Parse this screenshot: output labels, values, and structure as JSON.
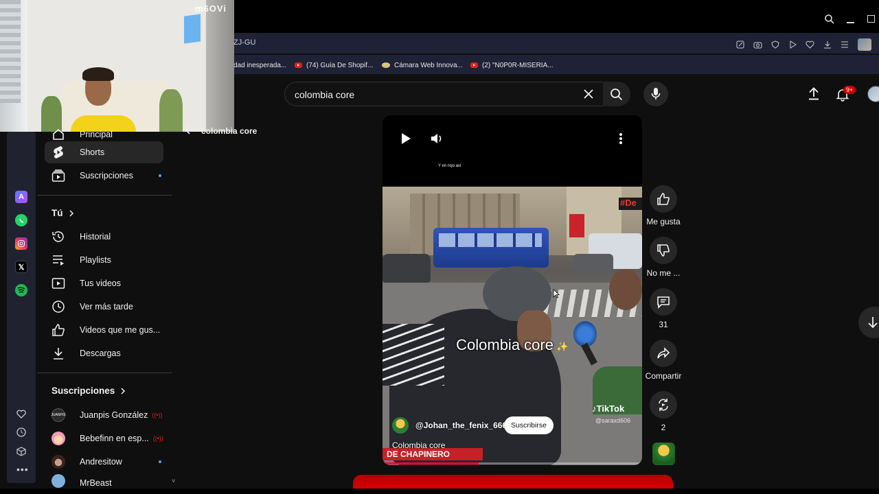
{
  "browser": {
    "url_fragment": "ZJ-GU",
    "bookmarks": [
      {
        "label": "dad inesperada...",
        "icon": "none"
      },
      {
        "label": "(74) Guía De Shopif...",
        "icon": "youtube-icon"
      },
      {
        "label": "Cámara Web Innova...",
        "icon": "cam-icon"
      },
      {
        "label": "(2) \"N0P0R-MISERIA...",
        "icon": "youtube-icon"
      }
    ]
  },
  "webcam": {
    "watermark": "m6OVi"
  },
  "search": {
    "query": "colombia core"
  },
  "topbar": {
    "notification_count": "9+"
  },
  "breadcrumb": {
    "label": "colombia core"
  },
  "sidebar": {
    "top_label": "Principal",
    "shorts": "Shorts",
    "subscriptions": "Suscripciones",
    "you_header": "Tú",
    "you_items": [
      {
        "label": "Historial",
        "icon": "history-icon"
      },
      {
        "label": "Playlists",
        "icon": "playlist-icon"
      },
      {
        "label": "Tus videos",
        "icon": "your-videos-icon"
      },
      {
        "label": "Ver más tarde",
        "icon": "clock-icon"
      },
      {
        "label": "Videos que me gus...",
        "icon": "thumbs-up-icon"
      },
      {
        "label": "Descargas",
        "icon": "download-icon"
      }
    ],
    "subs_header": "Suscripciones",
    "channels": [
      {
        "name": "Juanpis González",
        "live": true
      },
      {
        "name": "Bebefinn en esp...",
        "live": true
      },
      {
        "name": "Andresitow",
        "live": false
      },
      {
        "name": "MrBeast",
        "live": false
      }
    ]
  },
  "short": {
    "top_caption": "Y en rojo así",
    "overlay_text": "Colombia core",
    "tiktok_label": "TikTok",
    "tiktok_handle": "@saraxd606",
    "channel": "@Johan_the_fenix_666",
    "subscribe": "Suscribirse",
    "title": "Colombia core",
    "banner": "DE CHAPINERO",
    "sign": "#De",
    "progress": 0.37
  },
  "actions": {
    "like": "Me gusta",
    "dislike": "No me ...",
    "comments": "31",
    "share": "Compartir",
    "remix": "2"
  },
  "colors": {
    "accent": "#e62117",
    "bg": "#0f0f0f",
    "chip": "#272727"
  }
}
